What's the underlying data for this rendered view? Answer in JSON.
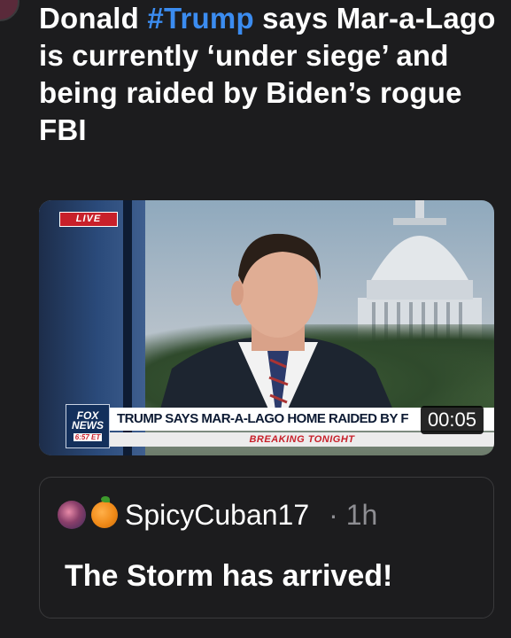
{
  "post": {
    "headline_part1": "Donald ",
    "hashtag": "#Trump",
    "headline_part2": " says Mar-a-Lago is currently ‘under siege’ and being raided by Biden’s rogue FBI"
  },
  "video": {
    "live_label": "LIVE",
    "network_line1": "FOX",
    "network_line2": "NEWS",
    "network_time": "6:57 ET",
    "chyron": "TRUMP SAYS MAR-A-LAGO HOME RAIDED BY F",
    "breaking_label": "BREAKING TONIGHT",
    "timer": "00:05"
  },
  "reply": {
    "username": "SpicyCuban17",
    "separator": "·",
    "time_ago": "1h",
    "text": "The Storm has arrived!"
  },
  "colors": {
    "background": "#1c1c1e",
    "hashtag": "#3b8cf0",
    "fox_red": "#c8202a",
    "muted_text": "#8e8e93"
  },
  "icons": [
    "avatar-icon",
    "orange-emoji-icon"
  ]
}
